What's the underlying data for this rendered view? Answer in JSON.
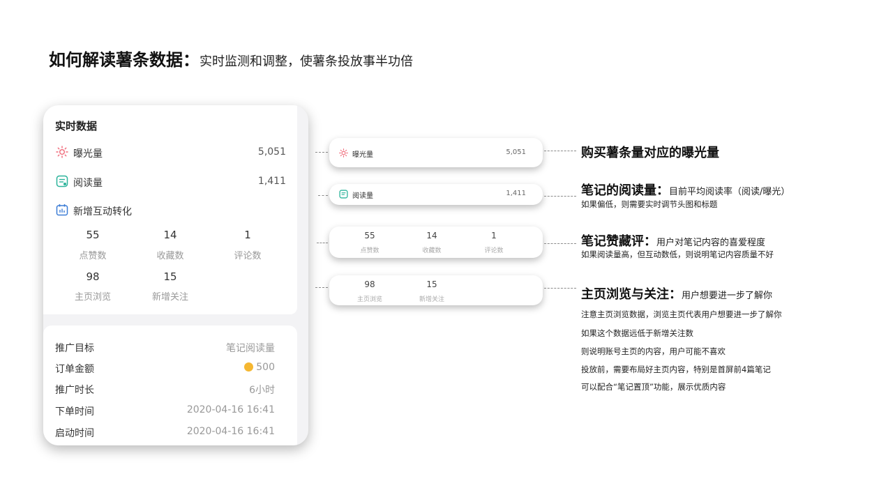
{
  "title": {
    "strong": "如何解读薯条数据",
    "colon": "：",
    "sub": "实时监测和调整，使薯条投放事半功倍"
  },
  "phone": {
    "section_title": "实时数据",
    "exposure": {
      "label": "曝光量",
      "value": "5,051"
    },
    "reads": {
      "label": "阅读量",
      "value": "1,411"
    },
    "interaction": {
      "label": "新增互动转化"
    },
    "stats_row1": [
      {
        "value": "55",
        "label": "点赞数"
      },
      {
        "value": "14",
        "label": "收藏数"
      },
      {
        "value": "1",
        "label": "评论数"
      }
    ],
    "stats_row2": [
      {
        "value": "98",
        "label": "主页浏览"
      },
      {
        "value": "15",
        "label": "新增关注"
      }
    ],
    "details": [
      {
        "label": "推广目标",
        "value": "笔记阅读量"
      },
      {
        "label": "订单金额",
        "value": "500"
      },
      {
        "label": "推广时长",
        "value": "6小时"
      },
      {
        "label": "下单时间",
        "value": "2020-04-16 16:41"
      },
      {
        "label": "启动时间",
        "value": "2020-04-16 16:41"
      }
    ]
  },
  "callouts": {
    "exposure": {
      "label": "曝光量",
      "value": "5,051"
    },
    "reads": {
      "label": "阅读量",
      "value": "1,411"
    },
    "row1": [
      {
        "value": "55",
        "label": "点赞数"
      },
      {
        "value": "14",
        "label": "收藏数"
      },
      {
        "value": "1",
        "label": "评论数"
      }
    ],
    "row2": [
      {
        "value": "98",
        "label": "主页浏览"
      },
      {
        "value": "15",
        "label": "新增关注"
      }
    ]
  },
  "annotations": {
    "a1": {
      "heading": "购买薯条量对应的曝光量"
    },
    "a2": {
      "heading": "笔记的阅读量：",
      "sub": "目前平均阅读率（阅读/曝光）",
      "line": "如果偏低，则需要实时调节头图和标题"
    },
    "a3": {
      "heading": "笔记赞藏评：",
      "sub": "用户对笔记内容的喜爱程度",
      "line": "如果阅读量高，但互动数低，则说明笔记内容质量不好"
    },
    "a4": {
      "heading": "主页浏览与关注：",
      "sub": "用户想要进一步了解你",
      "lines": [
        "注意主页浏览数据，浏览主页代表用户想要进一步了解你",
        "如果这个数据远低于新增关注数",
        "则说明账号主页的内容，用户可能不喜欢",
        "投放前，需要布局好主页内容，特别是首屏前4篇笔记",
        "可以配合“笔记置顶”功能，展示优质内容"
      ]
    }
  },
  "colors": {
    "exposure_icon": "#f06a7a",
    "reads_icon": "#2bb39a",
    "interaction_icon": "#3a7bd5",
    "coin": "#f5b731"
  },
  "icons": [
    "sun-icon",
    "document-icon",
    "calendar-chart-icon",
    "coin-icon"
  ]
}
